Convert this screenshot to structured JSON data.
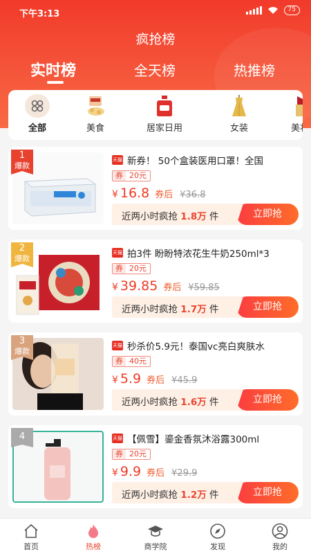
{
  "status_bar": {
    "time": "下午3:13",
    "battery": "75"
  },
  "page_title": "疯抢榜",
  "rank_tabs": [
    {
      "label": "实时榜",
      "active": true
    },
    {
      "label": "全天榜",
      "active": false
    },
    {
      "label": "热推榜",
      "active": false
    }
  ],
  "categories": [
    {
      "label": "全部",
      "icon": "grid-icon",
      "active": true
    },
    {
      "label": "美食",
      "icon": "food-icon"
    },
    {
      "label": "居家日用",
      "icon": "detergent-icon"
    },
    {
      "label": "女装",
      "icon": "dress-icon"
    },
    {
      "label": "美妆",
      "icon": "lipstick-icon"
    }
  ],
  "products": [
    {
      "rank": "1",
      "tag": "爆款",
      "store": "天猫",
      "title": "新券！ 50个盒装医用口罩！全国",
      "coupon_label": "券",
      "coupon_value": "20元",
      "yen": "¥",
      "price": "16.8",
      "after_coupon": "券后",
      "original_price": "¥36.8",
      "hot_prefix": "近两小时疯抢",
      "hot_count": "1.8万",
      "hot_unit": "件",
      "button": "立即抢"
    },
    {
      "rank": "2",
      "tag": "爆款",
      "store": "天猫",
      "title": "拍3件 盼盼特浓花生牛奶250ml*3",
      "coupon_label": "券",
      "coupon_value": "20元",
      "yen": "¥",
      "price": "39.85",
      "after_coupon": "券后",
      "original_price": "¥59.85",
      "hot_prefix": "近两小时疯抢",
      "hot_count": "1.7万",
      "hot_unit": "件",
      "button": "立即抢"
    },
    {
      "rank": "3",
      "tag": "爆款",
      "store": "天猫",
      "title": "秒杀价5.9元！泰国vc亮白爽肤水",
      "coupon_label": "券",
      "coupon_value": "40元",
      "yen": "¥",
      "price": "5.9",
      "after_coupon": "券后",
      "original_price": "¥45.9",
      "hot_prefix": "近两小时疯抢",
      "hot_count": "1.6万",
      "hot_unit": "件",
      "button": "立即抢"
    },
    {
      "rank": "4",
      "tag": "",
      "store": "天猫",
      "title": "【佩雪】鎏金香氛沐浴露300ml",
      "coupon_label": "券",
      "coupon_value": "20元",
      "yen": "¥",
      "price": "9.9",
      "after_coupon": "券后",
      "original_price": "¥29.9",
      "hot_prefix": "近两小时疯抢",
      "hot_count": "1.2万",
      "hot_unit": "件",
      "button": "立即抢"
    }
  ],
  "tabbar": [
    {
      "label": "首页",
      "icon": "home-icon"
    },
    {
      "label": "热榜",
      "icon": "flame-icon",
      "active": true
    },
    {
      "label": "商学院",
      "icon": "graduation-cap-icon"
    },
    {
      "label": "发现",
      "icon": "compass-icon"
    },
    {
      "label": "我的",
      "icon": "user-icon"
    }
  ]
}
